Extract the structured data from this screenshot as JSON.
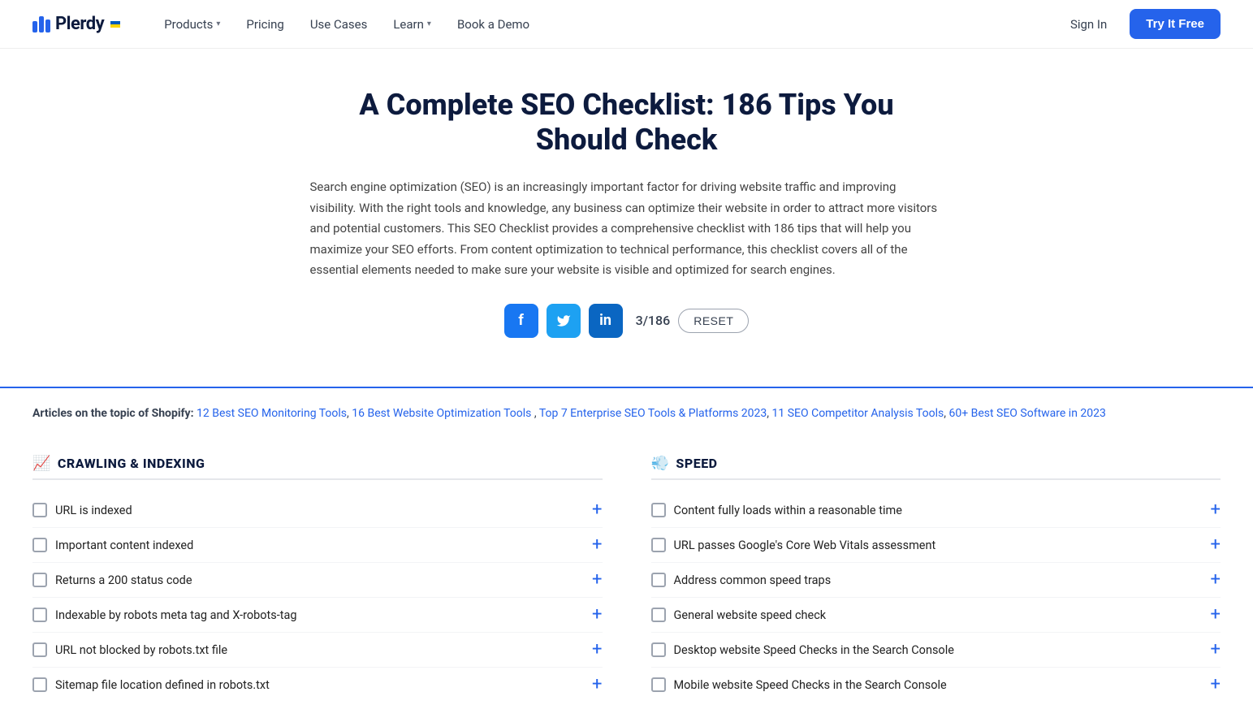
{
  "header": {
    "logo_text": "Plerdy",
    "nav_items": [
      {
        "label": "Products",
        "has_dropdown": true
      },
      {
        "label": "Pricing",
        "has_dropdown": false
      },
      {
        "label": "Use Cases",
        "has_dropdown": false
      },
      {
        "label": "Learn",
        "has_dropdown": true
      },
      {
        "label": "Book a Demo",
        "has_dropdown": false
      }
    ],
    "sign_in_label": "Sign In",
    "try_free_label": "Try It Free"
  },
  "hero": {
    "title": "A Complete SEO Checklist: 186 Tips You Should Check",
    "description": "Search engine optimization (SEO) is an increasingly important factor for driving website traffic and improving visibility. With the right tools and knowledge, any business can optimize their website in order to attract more visitors and potential customers. This SEO Checklist provides a comprehensive checklist with 186 tips that will help you maximize your SEO efforts. From content optimization to technical performance, this checklist covers all of the essential elements needed to make sure your website is visible and optimized for search engines."
  },
  "social": {
    "counter": "3/186",
    "reset_label": "RESET",
    "icons": [
      {
        "name": "facebook",
        "label": "f"
      },
      {
        "name": "twitter",
        "label": "t"
      },
      {
        "name": "linkedin",
        "label": "in"
      }
    ]
  },
  "articles": {
    "prefix_label": "Articles on the topic of Shopify:",
    "links": [
      "12 Best SEO Monitoring Tools",
      "16 Best Website Optimization Tools",
      "Top 7 Enterprise SEO Tools & Platforms 2023",
      "11 SEO Competitor Analysis Tools",
      "60+ Best SEO Software in 2023"
    ]
  },
  "sections": [
    {
      "id": "crawling",
      "icon": "📈",
      "title": "CRAWLING & INDEXING",
      "items": [
        "URL is indexed",
        "Important content indexed",
        "Returns a 200 status code",
        "Indexable by robots meta tag and X-robots-tag",
        "URL not blocked by robots.txt file",
        "Sitemap file location defined in robots.txt"
      ]
    },
    {
      "id": "speed",
      "icon": "💨",
      "title": "SPEED",
      "items": [
        "Content fully loads within a reasonable time",
        "URL passes Google's Core Web Vitals assessment",
        "Address common speed traps",
        "General website speed check",
        "Desktop website Speed Checks in the Search Console",
        "Mobile website Speed Checks in the Search Console"
      ]
    }
  ]
}
